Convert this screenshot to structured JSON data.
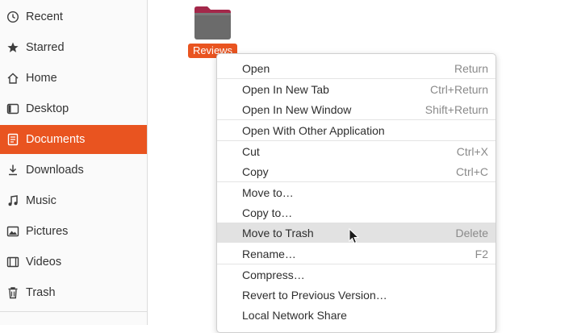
{
  "sidebar": {
    "items": [
      {
        "label": "Recent",
        "icon": "clock-icon"
      },
      {
        "label": "Starred",
        "icon": "star-icon"
      },
      {
        "label": "Home",
        "icon": "home-icon"
      },
      {
        "label": "Desktop",
        "icon": "desktop-icon"
      },
      {
        "label": "Documents",
        "icon": "document-icon",
        "active": true
      },
      {
        "label": "Downloads",
        "icon": "download-icon"
      },
      {
        "label": "Music",
        "icon": "music-icon"
      },
      {
        "label": "Pictures",
        "icon": "picture-icon"
      },
      {
        "label": "Videos",
        "icon": "video-icon"
      },
      {
        "label": "Trash",
        "icon": "trash-icon"
      }
    ]
  },
  "main": {
    "folder": {
      "name": "Reviews",
      "icon": "folder-icon",
      "selected": true
    }
  },
  "context_menu": {
    "items": [
      {
        "label": "Open",
        "shortcut": "Return"
      },
      {
        "label": "Open In New Tab",
        "shortcut": "Ctrl+Return"
      },
      {
        "label": "Open In New Window",
        "shortcut": "Shift+Return"
      },
      {
        "label": "Open With Other Application",
        "shortcut": ""
      },
      {
        "label": "Cut",
        "shortcut": "Ctrl+X"
      },
      {
        "label": "Copy",
        "shortcut": "Ctrl+C"
      },
      {
        "label": "Move to…",
        "shortcut": ""
      },
      {
        "label": "Copy to…",
        "shortcut": ""
      },
      {
        "label": "Move to Trash",
        "shortcut": "Delete",
        "hovered": true
      },
      {
        "label": "Rename…",
        "shortcut": "F2"
      },
      {
        "label": "Compress…",
        "shortcut": ""
      },
      {
        "label": "Revert to Previous Version…",
        "shortcut": ""
      },
      {
        "label": "Local Network Share",
        "shortcut": ""
      }
    ]
  },
  "colors": {
    "accent": "#e95420",
    "menu_hover": "#e2e2e2",
    "folder_body": "#6b6b6b",
    "folder_tab": "#a3284a"
  }
}
